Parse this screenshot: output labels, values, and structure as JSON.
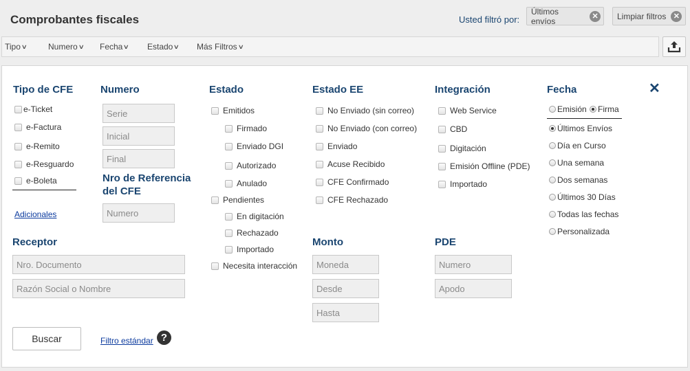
{
  "header": {
    "title": "Comprobantes fiscales",
    "filter_label": "Usted filtró por:",
    "chips": [
      {
        "label": "Últimos envíos",
        "icon": "close-circle-icon"
      },
      {
        "label": "Limpiar filtros",
        "icon": "close-circle-icon"
      }
    ]
  },
  "toolbar": {
    "items": [
      "Tipo",
      "Numero",
      "Fecha",
      "Estado",
      "Más Filtros"
    ],
    "upload_icon": "upload-icon"
  },
  "panel": {
    "close_icon": "close-icon",
    "tipo_cfe": {
      "title": "Tipo de CFE",
      "options": [
        "e-Ticket",
        "e-Factura",
        "e-Remito",
        "e-Resguardo",
        "e-Boleta"
      ],
      "adicionales": "Adicionales"
    },
    "numero": {
      "title": "Numero",
      "placeholders": [
        "Serie",
        "Inicial",
        "Final"
      ],
      "ref_title_1": "Nro de Referencia",
      "ref_title_2": "del CFE",
      "ref_placeholder": "Numero"
    },
    "estado": {
      "title": "Estado",
      "emitidos": "Emitidos",
      "emitidos_sub": [
        "Firmado",
        "Enviado DGI",
        "Autorizado",
        "Anulado"
      ],
      "pendientes": "Pendientes",
      "pendientes_sub": [
        "En digitación",
        "Rechazado",
        "Importado"
      ],
      "necesita": "Necesita interacción"
    },
    "estado_ee": {
      "title": "Estado EE",
      "options": [
        "No Enviado (sin correo)",
        "No Enviado (con correo)",
        "Enviado",
        "Acuse Recibido",
        "CFE Confirmado",
        "CFE Rechazado"
      ]
    },
    "integracion": {
      "title": "Integración",
      "options": [
        "Web Service",
        "CBD",
        "Digitación",
        "Emisión Offline (PDE)",
        "Importado"
      ]
    },
    "fecha": {
      "title": "Fecha",
      "type_options": [
        "Emisión",
        "Firma"
      ],
      "type_selected": "Firma",
      "ranges": [
        "Últimos Envíos",
        "Día en Curso",
        "Una semana",
        "Dos semanas",
        "Últimos 30 Días",
        "Todas las fechas",
        "Personalizada"
      ],
      "range_selected": "Últimos Envíos"
    },
    "receptor": {
      "title": "Receptor",
      "placeholders": [
        "Nro. Documento",
        "Razón Social o Nombre"
      ]
    },
    "monto": {
      "title": "Monto",
      "placeholders": [
        "Moneda",
        "Desde",
        "Hasta"
      ]
    },
    "pde": {
      "title": "PDE",
      "placeholders": [
        "Numero",
        "Apodo"
      ]
    },
    "buscar_label": "Buscar",
    "filtro_estandar": "Filtro estándar",
    "help_icon": "question-circle-icon"
  }
}
